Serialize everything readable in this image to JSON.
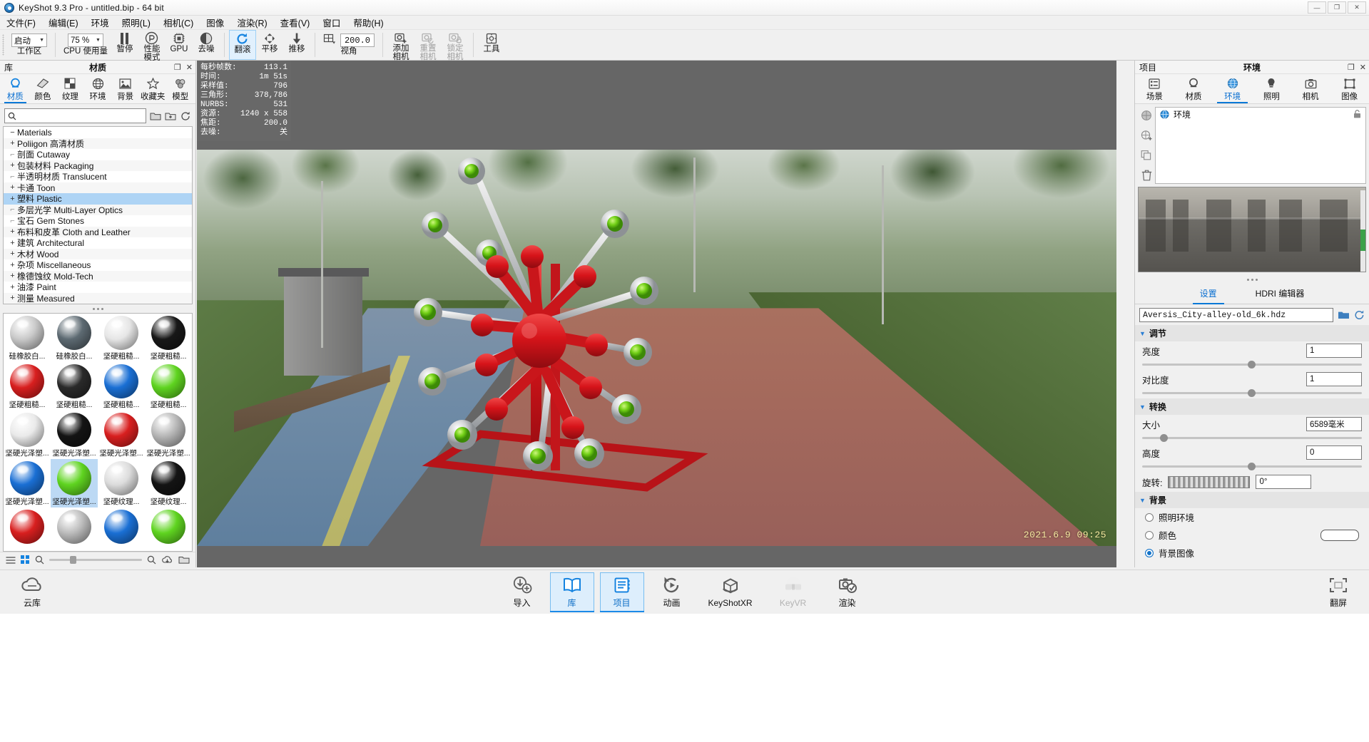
{
  "window": {
    "title": "KeyShot 9.3 Pro  - untitled.bip  - 64 bit",
    "app_icon": "keyshot-logo-icon",
    "minimize": "—",
    "maximize": "❐",
    "close": "✕"
  },
  "menubar": {
    "items": [
      {
        "label": "文件(F)",
        "name": "menu-file"
      },
      {
        "label": "编辑(E)",
        "name": "menu-edit"
      },
      {
        "label": "环境",
        "name": "menu-environment"
      },
      {
        "label": "照明(L)",
        "name": "menu-lighting"
      },
      {
        "label": "相机(C)",
        "name": "menu-camera"
      },
      {
        "label": "图像",
        "name": "menu-image"
      },
      {
        "label": "渲染(R)",
        "name": "menu-render"
      },
      {
        "label": "查看(V)",
        "name": "menu-view"
      },
      {
        "label": "窗口",
        "name": "menu-window"
      },
      {
        "label": "帮助(H)",
        "name": "menu-help"
      }
    ]
  },
  "toolbar": {
    "workspace": {
      "label": "工作区",
      "value": "启动"
    },
    "cpu_usage": {
      "label": "CPU 使用量",
      "value": "75 %"
    },
    "pause": {
      "label": "暂停",
      "icon": "pause-icon"
    },
    "performance_mode": {
      "label": "性能\n模式",
      "line1": "性能",
      "line2": "模式",
      "icon": "performance-icon"
    },
    "gpu": {
      "label": "GPU",
      "icon": "gpu-chip-icon"
    },
    "denoise": {
      "label": "去噪",
      "icon": "denoise-icon"
    },
    "tumble": {
      "label": "翻滚",
      "icon": "tumble-icon",
      "active": true
    },
    "pan": {
      "label": "平移",
      "icon": "pan-icon"
    },
    "dolly": {
      "label": "推移",
      "icon": "dolly-icon"
    },
    "perspective": {
      "label": "视角",
      "value": "200.0",
      "icon": "perspective-grid-icon"
    },
    "add_camera": {
      "line1": "添加",
      "line2": "相机",
      "icon": "add-camera-icon"
    },
    "reset_camera": {
      "line1": "重置",
      "line2": "相机",
      "icon": "reset-camera-icon"
    },
    "lock_camera": {
      "line1": "锁定",
      "line2": "相机",
      "icon": "lock-camera-icon"
    },
    "tools": {
      "label": "工具",
      "icon": "tools-icon"
    }
  },
  "library": {
    "panel_left_label": "库",
    "panel_title": "材质",
    "restore_icon": "restore-window-icon",
    "close_icon": "close-icon",
    "tabs": [
      {
        "label": "材质",
        "icon": "material-ball-icon",
        "selected": true
      },
      {
        "label": "颜色",
        "icon": "color-swatch-icon",
        "selected": false
      },
      {
        "label": "纹理",
        "icon": "texture-checker-icon",
        "selected": false
      },
      {
        "label": "环境",
        "icon": "globe-icon",
        "selected": false
      },
      {
        "label": "背景",
        "icon": "image-icon",
        "selected": false
      },
      {
        "label": "收藏夹",
        "icon": "star-icon",
        "selected": false
      },
      {
        "label": "模型",
        "icon": "model-cubes-icon",
        "selected": false
      }
    ],
    "search": {
      "placeholder": "",
      "value": "",
      "icon": "search-icon"
    },
    "search_buttons": [
      "folder-open-icon",
      "refresh-icon"
    ],
    "tree": [
      {
        "label": "Materials",
        "expander": "−",
        "level": 0,
        "selected": false
      },
      {
        "label": "Poliigon 高清材质",
        "expander": "+",
        "level": 1,
        "selected": false
      },
      {
        "label": "剖面 Cutaway",
        "expander": "",
        "level": 1,
        "selected": false
      },
      {
        "label": "包装材料 Packaging",
        "expander": "+",
        "level": 1,
        "selected": false
      },
      {
        "label": "半透明材质 Translucent",
        "expander": "",
        "level": 1,
        "selected": false
      },
      {
        "label": "卡通 Toon",
        "expander": "+",
        "level": 1,
        "selected": false
      },
      {
        "label": "塑料 Plastic",
        "expander": "+",
        "level": 1,
        "selected": true
      },
      {
        "label": "多层光学 Multi-Layer Optics",
        "expander": "",
        "level": 1,
        "selected": false
      },
      {
        "label": "宝石 Gem Stones",
        "expander": "",
        "level": 1,
        "selected": false
      },
      {
        "label": "布料和皮革 Cloth and Leather",
        "expander": "+",
        "level": 1,
        "selected": false
      },
      {
        "label": "建筑 Architectural",
        "expander": "+",
        "level": 1,
        "selected": false
      },
      {
        "label": "木材 Wood",
        "expander": "+",
        "level": 1,
        "selected": false
      },
      {
        "label": "杂项 Miscellaneous",
        "expander": "+",
        "level": 1,
        "selected": false
      },
      {
        "label": "橡德蚀纹 Mold-Tech",
        "expander": "+",
        "level": 1,
        "selected": false
      },
      {
        "label": "油漆 Paint",
        "expander": "+",
        "level": 1,
        "selected": false
      },
      {
        "label": "测量 Measured",
        "expander": "+",
        "level": 1,
        "selected": false
      }
    ],
    "materials": [
      {
        "name": "硅橡胶白...",
        "color": "#c9c9c9",
        "selected": false
      },
      {
        "name": "硅橡胶白...",
        "color": "#5d6a72",
        "selected": false
      },
      {
        "name": "坚硬粗糙...",
        "color": "#e6e6e6",
        "selected": false
      },
      {
        "name": "坚硬粗糙...",
        "color": "#181818",
        "selected": false
      },
      {
        "name": "坚硬粗糙...",
        "color": "#d81f1f",
        "selected": false
      },
      {
        "name": "坚硬粗糙...",
        "color": "#2a2a2a",
        "selected": false
      },
      {
        "name": "坚硬粗糙...",
        "color": "#1a6fd4",
        "selected": false
      },
      {
        "name": "坚硬粗糙...",
        "color": "#5fd420",
        "selected": false
      },
      {
        "name": "坚硬光泽塑...",
        "color": "#eaeaea",
        "selected": false
      },
      {
        "name": "坚硬光泽塑...",
        "color": "#141414",
        "selected": false
      },
      {
        "name": "坚硬光泽塑...",
        "color": "#d81f1f",
        "selected": false
      },
      {
        "name": "坚硬光泽塑...",
        "color": "#b7b7b7",
        "selected": false
      },
      {
        "name": "坚硬光泽塑...",
        "color": "#1a6fd4",
        "selected": false
      },
      {
        "name": "坚硬光泽塑...",
        "color": "#5fd420",
        "selected": true
      },
      {
        "name": "坚硬纹理...",
        "color": "#dcdcdc",
        "selected": false
      },
      {
        "name": "坚硬纹理...",
        "color": "#141414",
        "selected": false
      },
      {
        "name": "",
        "color": "#d81f1f",
        "selected": false
      },
      {
        "name": "",
        "color": "#bcbcbc",
        "selected": false
      },
      {
        "name": "",
        "color": "#1a6fd4",
        "selected": false
      },
      {
        "name": "",
        "color": "#5fd420",
        "selected": false
      }
    ],
    "footer_icons": [
      "list-view-icon",
      "grid-view-icon",
      "zoom-icon",
      "search-small-icon",
      "cloud-download-icon",
      "folder-icon"
    ]
  },
  "hud": {
    "rows": [
      {
        "key": "每秒帧数:",
        "value": "113.1"
      },
      {
        "key": "时间:",
        "value": "1m 51s"
      },
      {
        "key": "采样值:",
        "value": "796"
      },
      {
        "key": "三角形:",
        "value": "378,786"
      },
      {
        "key": "NURBS:",
        "value": "531"
      },
      {
        "key": "资源:",
        "value": "1240 x 558"
      },
      {
        "key": "焦距:",
        "value": "200.0"
      },
      {
        "key": "去噪:",
        "value": "关"
      }
    ]
  },
  "viewport": {
    "timestamp_watermark": "2021.6.9 09:25"
  },
  "project": {
    "panel_left_label": "项目",
    "panel_title": "环境",
    "restore_icon": "restore-window-icon",
    "close_icon": "close-icon",
    "tabs": [
      {
        "label": "场景",
        "icon": "scene-list-icon",
        "selected": false
      },
      {
        "label": "材质",
        "icon": "material-ball-icon",
        "selected": false
      },
      {
        "label": "环境",
        "icon": "globe-icon",
        "selected": true
      },
      {
        "label": "照明",
        "icon": "lightbulb-icon",
        "selected": false
      },
      {
        "label": "相机",
        "icon": "camera-icon",
        "selected": false
      },
      {
        "label": "图像",
        "icon": "image-frame-icon",
        "selected": false
      }
    ],
    "side_buttons": [
      "globe-icon",
      "add-environment-icon",
      "duplicate-environment-icon",
      "delete-trash-icon"
    ],
    "env_item": {
      "label": "环境",
      "icon": "globe-blue-icon",
      "lock_icon": "lock-open-icon"
    },
    "settings_tabs": [
      {
        "label": "设置",
        "selected": true
      },
      {
        "label": "HDRI 编辑器",
        "selected": false
      }
    ],
    "hdri_file": {
      "value": "Aversis_City-alley-old_6k.hdz",
      "browse_icon": "folder-open-icon",
      "reload_icon": "refresh-icon"
    },
    "sections": {
      "adjust": {
        "title": "调节",
        "props": [
          {
            "label": "亮度",
            "value": "1",
            "slider_pct": 50
          },
          {
            "label": "对比度",
            "value": "1",
            "slider_pct": 50
          }
        ]
      },
      "transform": {
        "title": "转换",
        "props": [
          {
            "label": "大小",
            "value": "6589毫米",
            "slider_pct": 9
          },
          {
            "label": "高度",
            "value": "0",
            "slider_pct": 50
          }
        ],
        "rotation": {
          "label": "旋转:",
          "value": "0°",
          "dial_icon": "rotation-dial"
        }
      },
      "background": {
        "title": "背景",
        "options": [
          {
            "label": "照明环境",
            "selected": false,
            "name": "radio-lighting-env"
          },
          {
            "label": "颜色",
            "selected": false,
            "name": "radio-color",
            "swatch": "#ffffff"
          },
          {
            "label": "背景图像",
            "selected": true,
            "name": "radio-background-image"
          }
        ]
      }
    }
  },
  "taskbar": {
    "items": [
      {
        "label": "导入",
        "icon": "import-icon",
        "selected": false,
        "dim": false
      },
      {
        "label": "库",
        "icon": "library-book-icon",
        "selected": true,
        "dim": false
      },
      {
        "label": "项目",
        "icon": "project-notebook-icon",
        "selected": true,
        "dim": false
      },
      {
        "label": "动画",
        "icon": "animation-play-icon",
        "selected": false,
        "dim": false
      },
      {
        "label": "KeyShotXR",
        "icon": "keyshotxr-cube-icon",
        "selected": false,
        "dim": false
      },
      {
        "label": "KeyVR",
        "icon": "keyvr-headset-icon",
        "selected": false,
        "dim": true
      },
      {
        "label": "渲染",
        "icon": "render-camera-icon",
        "selected": false,
        "dim": false
      }
    ],
    "cloud": {
      "label": "云库",
      "icon": "cloud-icon"
    },
    "fullscreen": {
      "label": "翻屏",
      "icon": "fullscreen-icon"
    }
  }
}
